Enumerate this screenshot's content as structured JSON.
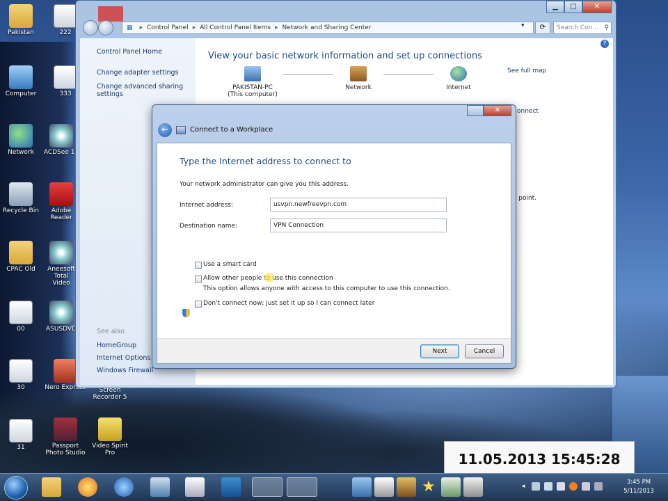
{
  "desktop": {
    "icons": [
      {
        "label": "Pakistan",
        "icon": "folder-icon"
      },
      {
        "label": "222",
        "icon": "document-icon"
      },
      {
        "label": "Computer",
        "icon": "computer-icon"
      },
      {
        "label": "333",
        "icon": "document-icon"
      },
      {
        "label": "Network",
        "icon": "network-icon"
      },
      {
        "label": "ACDSee 15",
        "icon": "camera-icon"
      },
      {
        "label": "Recycle Bin",
        "icon": "recycle-bin-icon"
      },
      {
        "label": "Adobe Reader",
        "icon": "pdf-icon"
      },
      {
        "label": "CPAC Old",
        "icon": "folder-icon"
      },
      {
        "label": "Aneesoft Total Video",
        "icon": "video-icon"
      },
      {
        "label": "00",
        "icon": "document-icon"
      },
      {
        "label": "ASUSDVD",
        "icon": "disc-icon"
      },
      {
        "label": "30",
        "icon": "document-icon"
      },
      {
        "label": "Nero Express",
        "icon": "nero-icon"
      },
      {
        "label": "Screen Recorder 5",
        "icon": "recorder-icon"
      },
      {
        "label": "31",
        "icon": "document-icon"
      },
      {
        "label": "Passport Photo Studio",
        "icon": "passport-icon"
      },
      {
        "label": "Video Spirit Pro",
        "icon": "video-spirit-icon"
      }
    ]
  },
  "control_panel": {
    "breadcrumb": [
      "Control Panel",
      "All Control Panel Items",
      "Network and Sharing Center"
    ],
    "search_placeholder": "Search Con...",
    "left_links": [
      "Control Panel Home",
      "Change adapter settings",
      "Change advanced sharing",
      "settings"
    ],
    "see_also_label": "See also",
    "see_also_links": [
      "HomeGroup",
      "Internet Options",
      "Windows Firewall"
    ],
    "heading": "View your basic network information and set up connections",
    "see_full_map": "See full map",
    "nodes": {
      "pc_name": "PAKISTAN-PC",
      "pc_sub": "(This computer)",
      "network": "Network",
      "internet": "Internet"
    },
    "partial_connect": "onnect",
    "partial_point": "ss point."
  },
  "dialog": {
    "title": "Connect to a Workplace",
    "heading": "Type the Internet address to connect to",
    "instruction": "Your network administrator can give you this address.",
    "internet_address_label": "Internet address:",
    "internet_address_value": "usvpn.newfreevpn.com",
    "destination_label": "Destination name:",
    "destination_value": "VPN Connection",
    "smart_card": "Use a smart card",
    "allow_others": "Allow other people to use this connection",
    "allow_others_sub": "This option allows anyone with access to this computer to use this connection.",
    "dont_connect": "Don't connect now; just set it up so I can connect later",
    "next": "Next",
    "cancel": "Cancel"
  },
  "overlay": {
    "timestamp": "11.05.2013 15:45:28"
  },
  "taskbar": {
    "time": "3:45 PM",
    "date": "5/11/2013"
  }
}
